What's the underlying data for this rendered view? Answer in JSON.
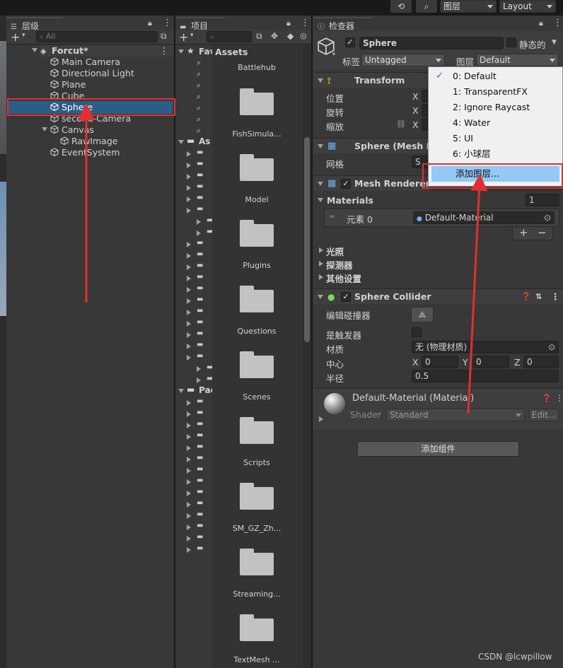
{
  "top_toolbar": {
    "layers_label": "图层",
    "layout_label": "Layout"
  },
  "hierarchy": {
    "tab_label": "层级",
    "search_placeholder": "All",
    "scene_name": "Forcut*",
    "items": [
      {
        "label": "Main Camera"
      },
      {
        "label": "Directional Light"
      },
      {
        "label": "Plane"
      },
      {
        "label": "Cube"
      },
      {
        "label": "Sphere"
      },
      {
        "label": "second-Camera"
      },
      {
        "label": "Canvas"
      },
      {
        "label": "RawImage"
      },
      {
        "label": "EventSystem"
      }
    ]
  },
  "project": {
    "tab_label": "项目",
    "favorites_label": "Fav",
    "assets_tree_label": "As",
    "packages_label": "Pac",
    "assets_header": "Assets",
    "folders": [
      {
        "label": "Battlehub"
      },
      {
        "label": "FishSimula..."
      },
      {
        "label": "Model"
      },
      {
        "label": "Plugins"
      },
      {
        "label": "Questions"
      },
      {
        "label": "Scenes"
      },
      {
        "label": "Scripts"
      },
      {
        "label": "SM_GZ_Zh..."
      },
      {
        "label": "Streaming..."
      },
      {
        "label": "TextMesh ..."
      }
    ]
  },
  "inspector": {
    "tab_label": "检查器",
    "object_name": "Sphere",
    "static_label": "静态的",
    "tag_label": "标签",
    "tag_value": "Untagged",
    "layer_label": "图层",
    "layer_value": "Default",
    "transform": {
      "title": "Transform",
      "position_label": "位置",
      "rotation_label": "旋转",
      "scale_label": "缩放",
      "x_label": "X"
    },
    "mesh_filter": {
      "title": "Sphere (Mesh Filter)",
      "mesh_label": "网格",
      "mesh_value": "S"
    },
    "mesh_renderer": {
      "title": "Mesh Renderer",
      "materials_label": "Materials",
      "materials_count": "1",
      "element_label": "元素 0",
      "element_value": "Default-Material",
      "lighting_label": "光照",
      "probes_label": "探测器",
      "other_settings_label": "其他设置"
    },
    "sphere_collider": {
      "title": "Sphere Collider",
      "edit_collider_label": "编辑碰撞器",
      "is_trigger_label": "是触发器",
      "material_label": "材质",
      "material_value": "无 (物理材质)",
      "center_label": "中心",
      "center_x": "0",
      "center_y": "0",
      "center_z": "0",
      "x_label": "X",
      "y_label": "Y",
      "z_label": "Z",
      "radius_label": "半径",
      "radius_value": "0.5"
    },
    "material": {
      "title": "Default-Material (Material)",
      "shader_label": "Shader",
      "shader_value": "Standard",
      "edit_label": "Edit..."
    },
    "add_component_label": "添加组件"
  },
  "layer_menu": {
    "items": [
      {
        "label": "0: Default",
        "checked": true
      },
      {
        "label": "1: TransparentFX",
        "checked": false
      },
      {
        "label": "2: Ignore Raycast",
        "checked": false
      },
      {
        "label": "4: Water",
        "checked": false
      },
      {
        "label": "5: UI",
        "checked": false
      },
      {
        "label": "6: 小球层",
        "checked": false
      }
    ],
    "add_layer_label": "添加图层..."
  },
  "watermark": "CSDN @lcwpillow",
  "colors": {
    "selection": "#2c5d87",
    "annotation_red": "#e03030",
    "menu_highlight": "#94c8f5"
  }
}
